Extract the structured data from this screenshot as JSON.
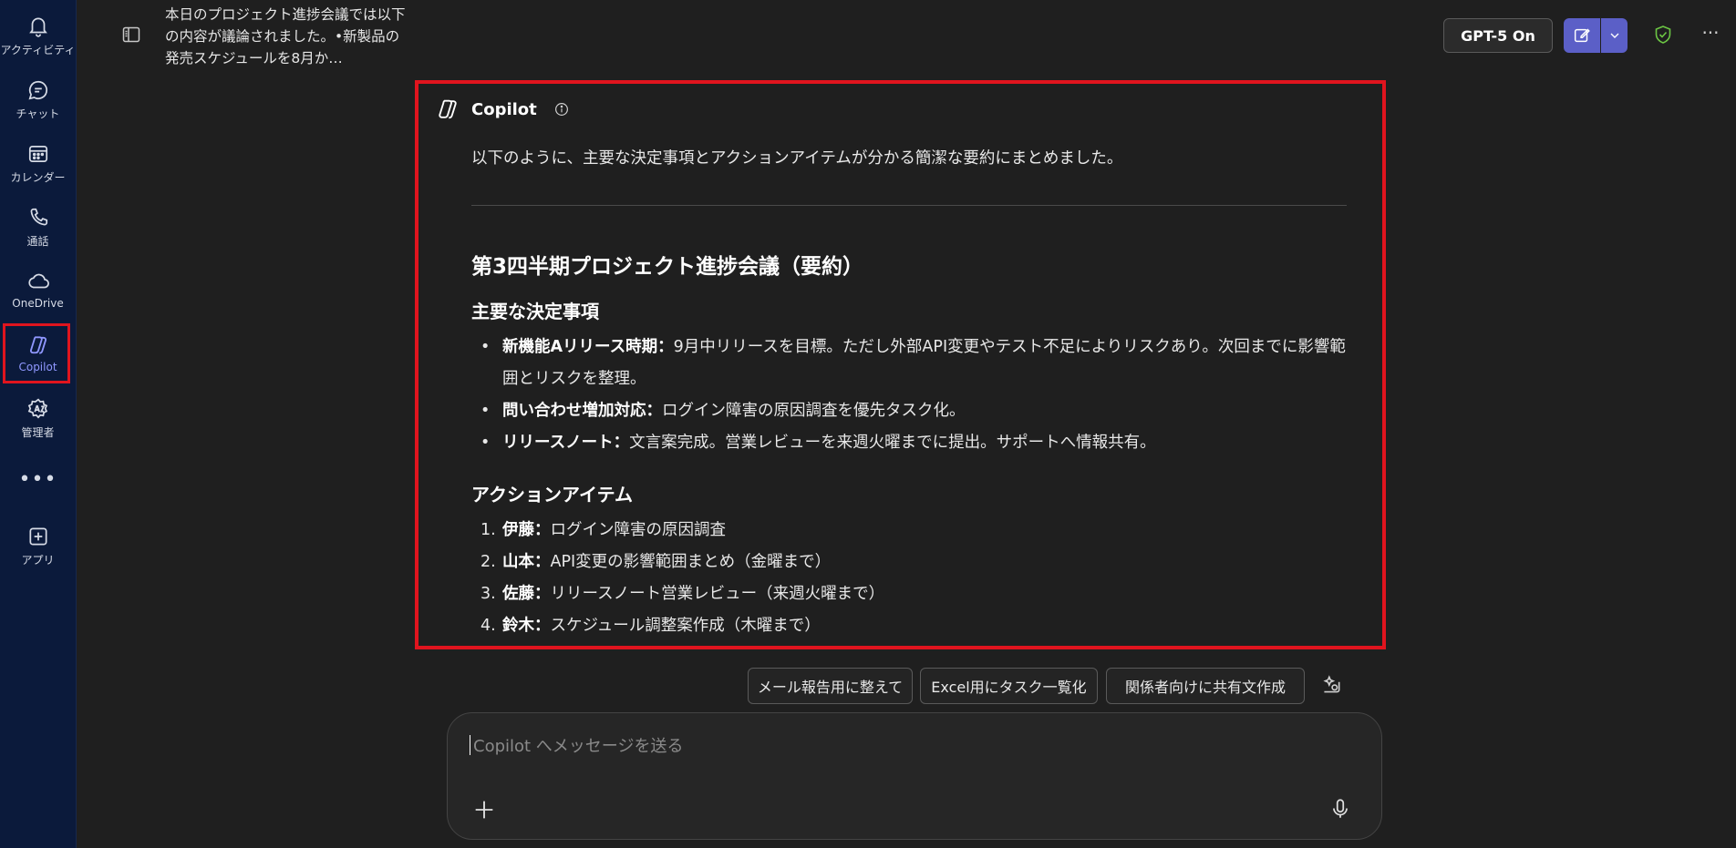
{
  "rail": {
    "items": [
      {
        "label": "アクティビティ",
        "icon": "bell-icon"
      },
      {
        "label": "チャット",
        "icon": "chat-icon"
      },
      {
        "label": "カレンダー",
        "icon": "calendar-icon"
      },
      {
        "label": "通話",
        "icon": "phone-icon"
      },
      {
        "label": "OneDrive",
        "icon": "cloud-icon"
      },
      {
        "label": "Copilot",
        "icon": "copilot-icon"
      },
      {
        "label": "管理者",
        "icon": "admin-icon"
      },
      {
        "label": "アプリ",
        "icon": "add-app-icon"
      }
    ],
    "more": "•••"
  },
  "header": {
    "chat_title": "本日のプロジェクト進捗会議では以下の内容が議論されました。•新製品の発売スケジュールを8月か…",
    "gpt_label": "GPT-5 On",
    "more": "···"
  },
  "response": {
    "sender": "Copilot",
    "intro": "以下のように、主要な決定事項とアクションアイテムが分かる簡潔な要約にまとめました。",
    "title": "第3四半期プロジェクト進捗会議（要約）",
    "decisions_heading": "主要な決定事項",
    "decisions": [
      {
        "bullet": "•",
        "term": "新機能Aリリース時期：",
        "text": "9月中リリースを目標。ただし外部API変更やテスト不足によりリスクあり。次回までに影響範囲とリスクを整理。"
      },
      {
        "bullet": "•",
        "term": "問い合わせ増加対応：",
        "text": "ログイン障害の原因調査を優先タスク化。"
      },
      {
        "bullet": "•",
        "term": "リリースノート：",
        "text": "文言案完成。営業レビューを来週火曜までに提出。サポートへ情報共有。"
      }
    ],
    "actions_heading": "アクションアイテム",
    "actions": [
      {
        "num": "1.",
        "name": "伊藤：",
        "task": "ログイン障害の原因調査"
      },
      {
        "num": "2.",
        "name": "山本：",
        "task": "API変更の影響範囲まとめ（金曜まで）"
      },
      {
        "num": "3.",
        "name": "佐藤：",
        "task": "リリースノート営業レビュー（来週火曜まで）"
      },
      {
        "num": "4.",
        "name": "鈴木：",
        "task": "スケジュール調整案作成（木曜まで）"
      }
    ]
  },
  "suggestions": [
    "メール報告用に整えて",
    "Excel用にタスク一覧化",
    "関係者向けに共有文作成"
  ],
  "composer": {
    "placeholder": "Copilot へメッセージを送る"
  },
  "colors": {
    "accent": "#5b5fc7",
    "highlight": "#e0141e",
    "rail_bg": "#0b1a3b",
    "active_rail": "#8f97ff"
  }
}
